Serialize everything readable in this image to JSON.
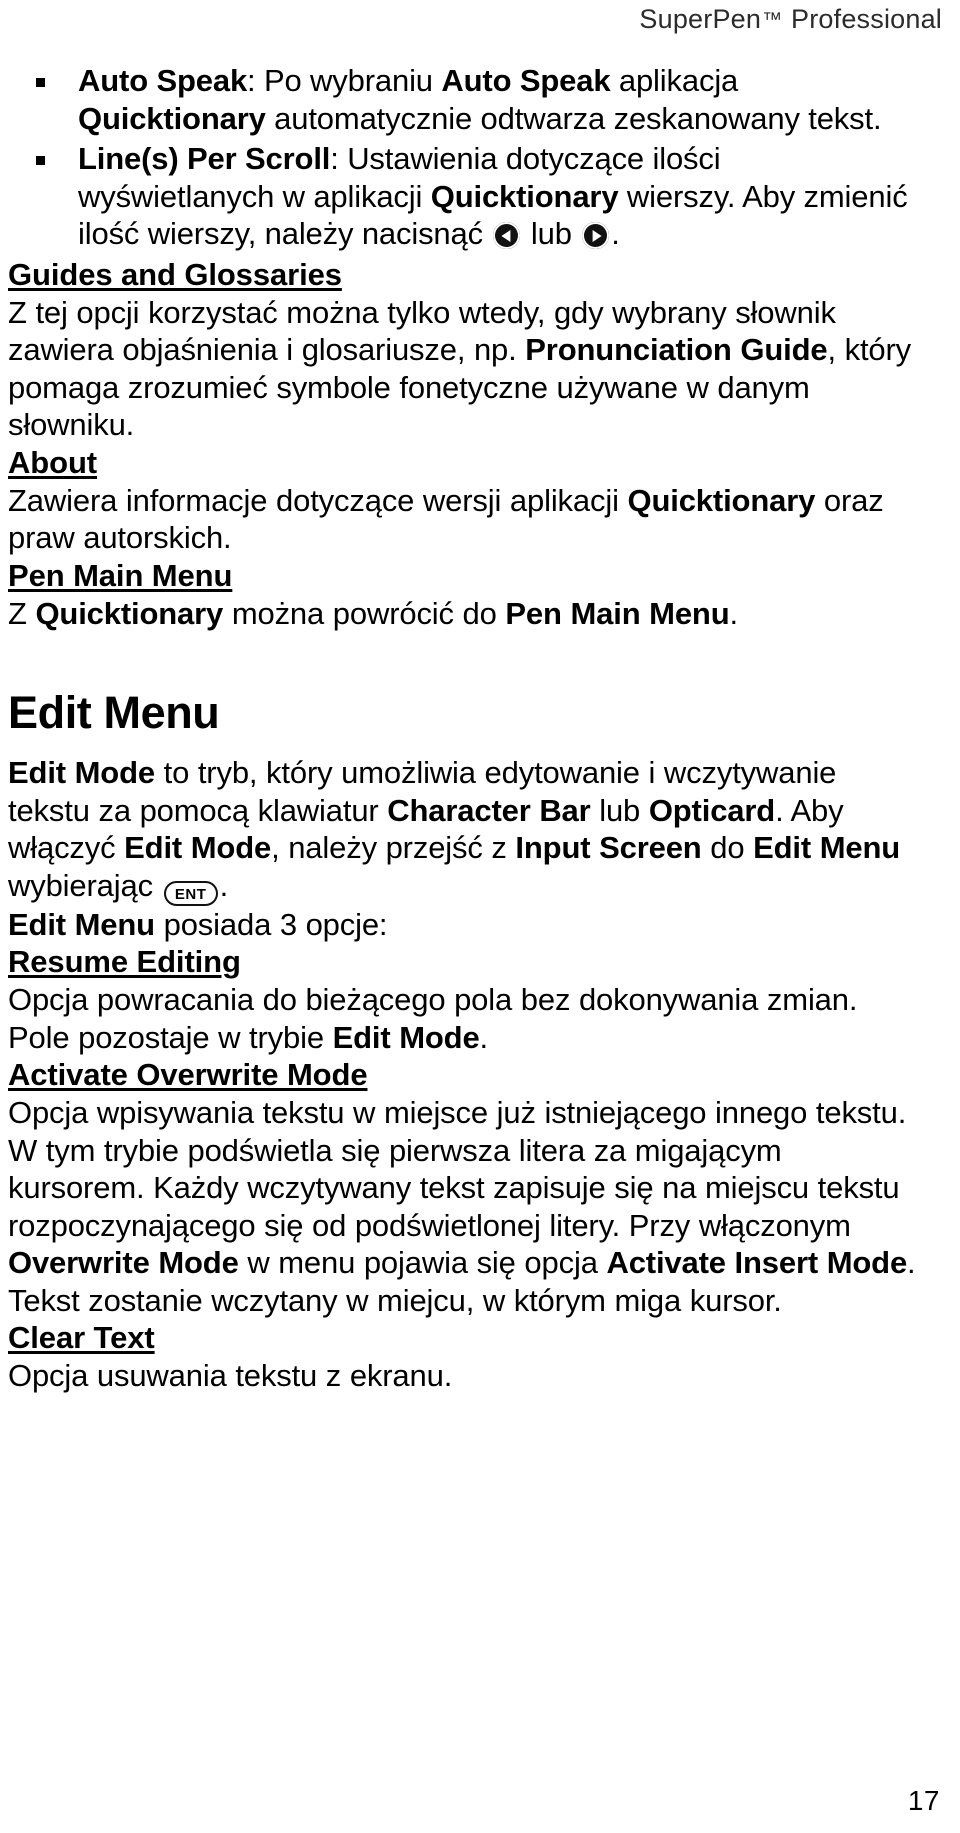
{
  "header": {
    "product": "SuperPen",
    "trademark": "™",
    "edition": "Professional"
  },
  "bullets": [
    {
      "segments": [
        {
          "text": "Auto Speak",
          "bold": true
        },
        {
          "text": ": Po wybraniu ",
          "bold": false
        },
        {
          "text": "Auto Speak",
          "bold": true
        },
        {
          "text": " aplikacja ",
          "bold": false
        },
        {
          "text": "Quicktionary",
          "bold": true
        },
        {
          "text": " automatycznie odtwarza zeskanowany tekst.",
          "bold": false
        }
      ]
    },
    {
      "segments": [
        {
          "text": "Line(s) Per Scroll",
          "bold": true
        },
        {
          "text": ": Ustawienia dotyczące ilości wyświetlanych w aplikacji ",
          "bold": false
        },
        {
          "text": "Quicktionary",
          "bold": true
        },
        {
          "text": " wierszy. Aby zmienić ilość wierszy, należy nacisnąć ",
          "bold": false
        },
        {
          "icon": "scroll-up-circle-icon"
        },
        {
          "text": " lub ",
          "bold": false
        },
        {
          "icon": "scroll-down-circle-icon"
        },
        {
          "text": ".",
          "bold": false
        }
      ]
    }
  ],
  "sections": [
    {
      "heading": "Guides and Glossaries",
      "body": [
        {
          "text": "Z tej opcji korzystać można tylko wtedy, gdy wybrany słownik zawiera objaśnienia i glosariusze, np. ",
          "bold": false
        },
        {
          "text": "Pronunciation Guide",
          "bold": true
        },
        {
          "text": ", który pomaga zrozumieć symbole fonetyczne używane w danym słowniku.",
          "bold": false
        }
      ]
    },
    {
      "heading": "About",
      "body": [
        {
          "text": "Zawiera informacje dotyczące wersji aplikacji ",
          "bold": false
        },
        {
          "text": "Quicktionary",
          "bold": true
        },
        {
          "text": " oraz praw autorskich.",
          "bold": false
        }
      ]
    },
    {
      "heading": "Pen Main Menu",
      "body": [
        {
          "text": "Z ",
          "bold": false
        },
        {
          "text": "Quicktionary",
          "bold": true
        },
        {
          "text": " można powrócić do ",
          "bold": false
        },
        {
          "text": "Pen Main Menu",
          "bold": true
        },
        {
          "text": ".",
          "bold": false
        }
      ]
    }
  ],
  "chapter": {
    "title": "Edit Menu",
    "intro": [
      {
        "text": "Edit Mode",
        "bold": true
      },
      {
        "text": " to tryb, który umożliwia edytowanie i wczytywanie tekstu za pomocą klawiatur ",
        "bold": false
      },
      {
        "text": "Character Bar",
        "bold": true
      },
      {
        "text": " lub ",
        "bold": false
      },
      {
        "text": "Opticard",
        "bold": true
      },
      {
        "text": ". Aby włączyć ",
        "bold": false
      },
      {
        "text": "Edit Mode",
        "bold": true
      },
      {
        "text": ", należy przejść z ",
        "bold": false
      },
      {
        "text": "Input Screen",
        "bold": true
      },
      {
        "text": " do ",
        "bold": false
      },
      {
        "text": "Edit Menu",
        "bold": true
      },
      {
        "text": " wybierając ",
        "bold": false
      },
      {
        "icon": "ent-key-icon",
        "label": "ENT"
      },
      {
        "text": ".",
        "bold": false
      }
    ],
    "options_line": [
      {
        "text": "Edit Menu",
        "bold": true
      },
      {
        "text": " posiada 3 opcje:",
        "bold": false
      }
    ],
    "options": [
      {
        "heading": "Resume Editing",
        "body": [
          {
            "text": "Opcja powracania do bieżącego pola bez dokonywania zmian. Pole pozostaje w trybie ",
            "bold": false
          },
          {
            "text": "Edit Mode",
            "bold": true
          },
          {
            "text": ".",
            "bold": false
          }
        ]
      },
      {
        "heading": "Activate Overwrite Mode",
        "body": [
          {
            "text": "Opcja wpisywania tekstu w miejsce już istniejącego innego tekstu. W tym trybie podświetla się pierwsza litera za migającym kursorem. Każdy wczytywany tekst zapisuje się na miejscu tekstu rozpoczynającego się od podświetlonej litery. Przy włączonym ",
            "bold": false
          },
          {
            "text": "Overwrite Mode",
            "bold": true
          },
          {
            "text": " w menu pojawia się opcja ",
            "bold": false
          },
          {
            "text": "Activate Insert Mode",
            "bold": true
          },
          {
            "text": ". Tekst zostanie wczytany w miejcu, w którym miga kursor.",
            "bold": false
          }
        ]
      },
      {
        "heading": "Clear Text",
        "body": [
          {
            "text": "Opcja usuwania tekstu z ekranu.",
            "bold": false
          }
        ]
      }
    ]
  },
  "page_number": "17",
  "colors": {
    "text": "#000000",
    "header_text": "#2b2b2b",
    "background": "#ffffff"
  }
}
